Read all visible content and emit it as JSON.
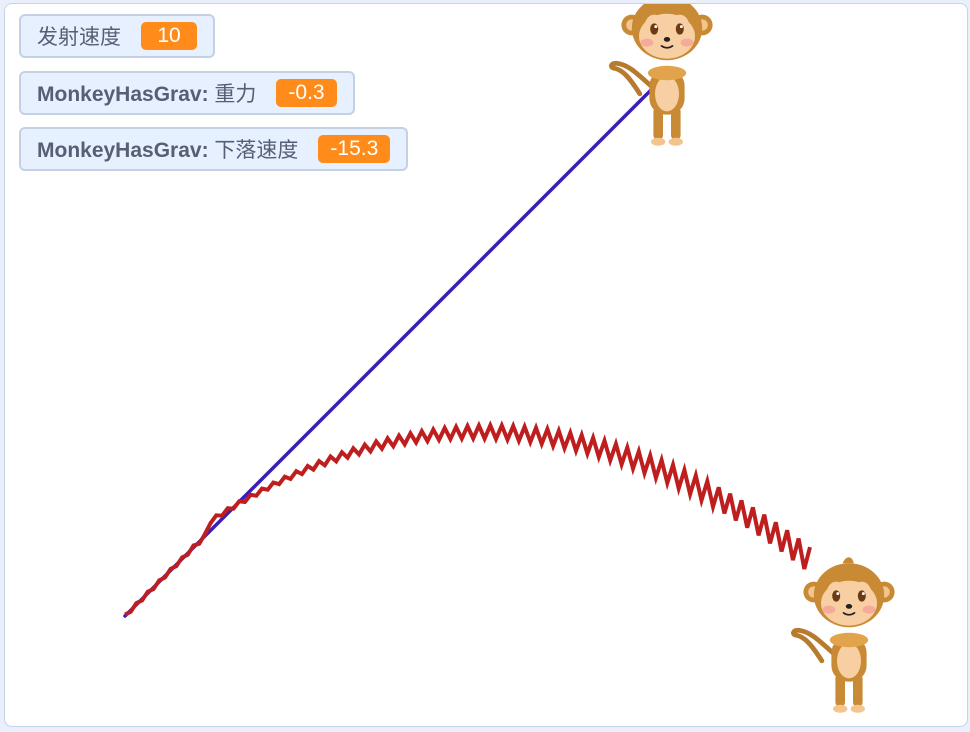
{
  "monitors": [
    {
      "sprite": "",
      "name": "发射速度",
      "value": "10"
    },
    {
      "sprite": "MonkeyHasGrav:",
      "name": "重力",
      "value": "-0.3"
    },
    {
      "sprite": "MonkeyHasGrav:",
      "name": "下落速度",
      "value": "-15.3"
    }
  ],
  "colors": {
    "straight_path": "#3a1fb6",
    "gravity_path": "#bf1e1e",
    "monitor_value": "#ff8c1a",
    "monkey_fur": "#c98a36"
  },
  "sprites": {
    "monkey_top": "monkey-sprite",
    "monkey_bottom": "monkey-sprite"
  }
}
